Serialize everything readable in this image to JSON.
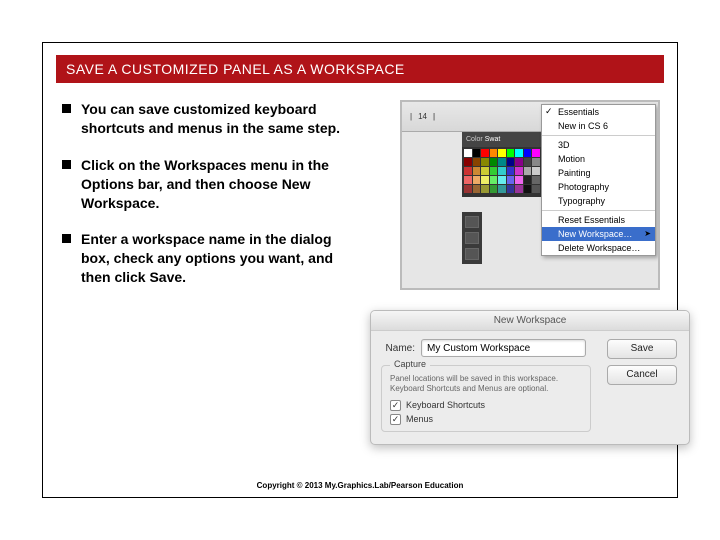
{
  "title": "SAVE A CUSTOMIZED PANEL AS A WORKSPACE",
  "bullets": [
    "You can save customized keyboard shortcuts and menus in the same step.",
    "Click on the Workspaces menu in the Options bar, and then choose New Workspace.",
    "Enter a workspace name in the dialog box, check any options you want, and then click Save."
  ],
  "copyright": "Copyright © 2013 My.Graphics.Lab/Pearson Education",
  "fig1": {
    "tab_num": "14",
    "swatch_tabs": [
      "Color",
      "Swat"
    ],
    "menu": {
      "items_top": [
        "Essentials",
        "New in CS 6"
      ],
      "items_mid": [
        "3D",
        "Motion",
        "Painting",
        "Photography",
        "Typography"
      ],
      "reset": "Reset Essentials",
      "new_ws": "New Workspace…",
      "delete_ws": "Delete Workspace…"
    },
    "swatch_colors": [
      "#fff",
      "#000",
      "#f00",
      "#ff8800",
      "#ff0",
      "#0f0",
      "#0ff",
      "#00f",
      "#f0f",
      "#800",
      "#840",
      "#880",
      "#080",
      "#088",
      "#008",
      "#808",
      "#444",
      "#888",
      "#c33",
      "#c83",
      "#cc3",
      "#3c3",
      "#3cc",
      "#33c",
      "#c3c",
      "#aaa",
      "#ccc",
      "#e66",
      "#ea6",
      "#ee6",
      "#6e6",
      "#6ee",
      "#66e",
      "#e6e",
      "#222",
      "#666",
      "#933",
      "#963",
      "#993",
      "#393",
      "#399",
      "#339",
      "#939",
      "#111",
      "#555"
    ]
  },
  "fig2": {
    "dialog_title": "New Workspace",
    "name_label": "Name:",
    "name_value": "My Custom Workspace",
    "capture_legend": "Capture",
    "capture_note": "Panel locations will be saved in this workspace.\nKeyboard Shortcuts and Menus are optional.",
    "cb1": "Keyboard Shortcuts",
    "cb2": "Menus",
    "save": "Save",
    "cancel": "Cancel"
  }
}
